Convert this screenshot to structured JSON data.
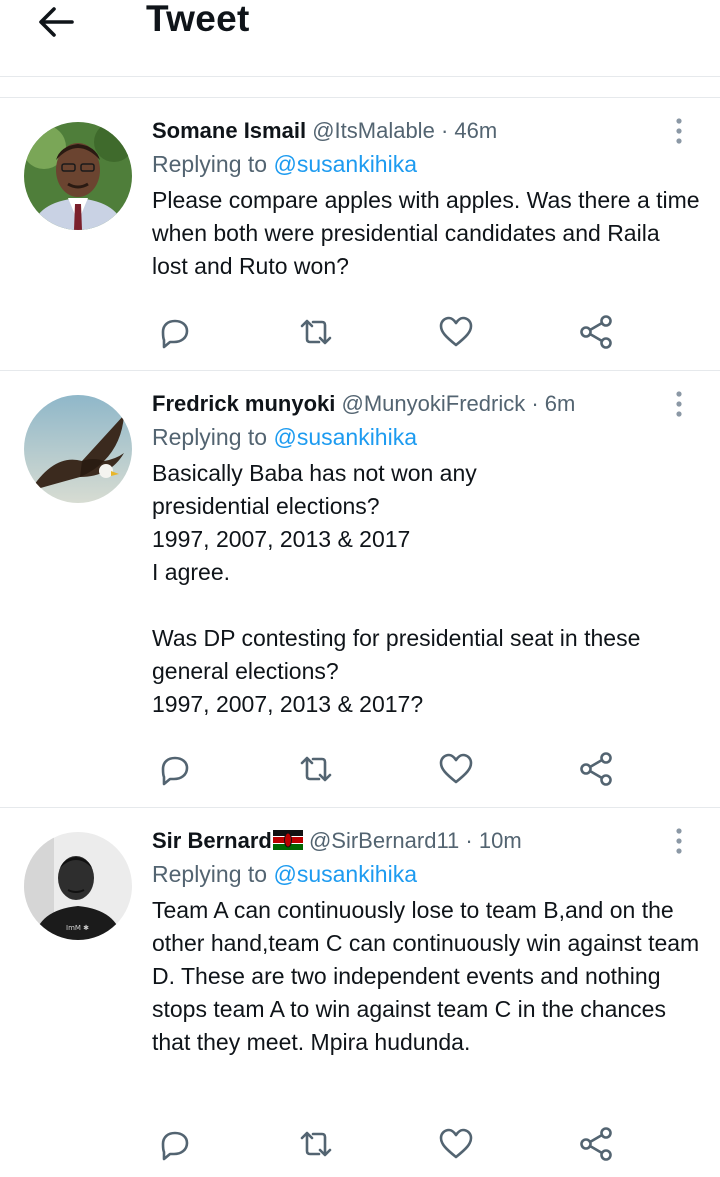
{
  "header": {
    "title": "Tweet"
  },
  "tweets": [
    {
      "author": "Somane Ismail",
      "handle": "@ItsMalable",
      "dot": "·",
      "time": "46m",
      "replying_prefix": "Replying to ",
      "replying_to": "@susankihika",
      "text": "Please compare apples with apples. Was there a time when both were presidential candidates and Raila lost and Ruto won?"
    },
    {
      "author": "Fredrick munyoki",
      "handle": "@MunyokiFredrick",
      "dot": "·",
      "time": "6m",
      "replying_prefix": "Replying to ",
      "replying_to": "@susankihika",
      "text": "Basically Baba has not won any\npresidential elections?\n1997, 2007, 2013 & 2017\n I agree.\n\nWas DP contesting for presidential seat in these general elections?\n1997, 2007, 2013 & 2017?"
    },
    {
      "author": "Sir Bernard",
      "handle": "@SirBernard11",
      "dot": "·",
      "time": "10m",
      "replying_prefix": "Replying to ",
      "replying_to": "@susankihika",
      "text": "Team A can continuously lose to team B,and on the other hand,team C can continuously win against team D. These are two independent events and nothing stops team A to win against team C in the chances that they meet. Mpira hudunda."
    }
  ],
  "icons": {
    "back": "arrow-left-icon",
    "more": "more-vertical-icon",
    "reply": "reply-icon",
    "retweet": "retweet-icon",
    "like": "heart-icon",
    "share": "share-icon",
    "flag": "kenya-flag-icon"
  },
  "colors": {
    "link": "#1d9bf0",
    "secondary": "#536471",
    "text": "#0f1419",
    "divider": "#e6e9ec"
  }
}
